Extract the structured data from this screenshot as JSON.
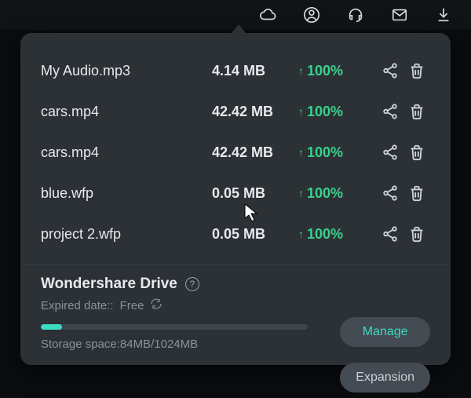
{
  "top_icons": [
    "cloud-icon",
    "profile-icon",
    "headset-icon",
    "mail-icon",
    "download-icon"
  ],
  "files": [
    {
      "name": "My Audio.mp3",
      "size": "4.14 MB",
      "progress": "100%"
    },
    {
      "name": "cars.mp4",
      "size": "42.42 MB",
      "progress": "100%"
    },
    {
      "name": "cars.mp4",
      "size": "42.42 MB",
      "progress": "100%"
    },
    {
      "name": "blue.wfp",
      "size": "0.05 MB",
      "progress": "100%"
    },
    {
      "name": "project 2.wfp",
      "size": "0.05 MB",
      "progress": "100%"
    }
  ],
  "drive": {
    "title": "Wondershare Drive",
    "expired_label": "Expired date::",
    "expired_value": "Free",
    "storage_label": "Storage space:",
    "storage_used": "84MB",
    "storage_total": "1024MB",
    "bar_percent": 8
  },
  "buttons": {
    "manage": "Manage",
    "expansion": "Expansion"
  },
  "colors": {
    "accent": "#3bdcc3",
    "progress": "#38d28c"
  }
}
